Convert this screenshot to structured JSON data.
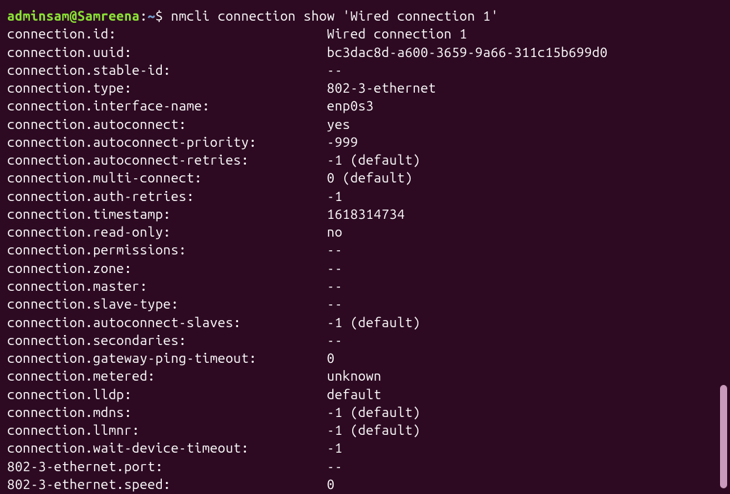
{
  "prompt": {
    "user_host": "adminsam@Samreena",
    "colon": ":",
    "path": "~",
    "dollar": "$ ",
    "command": "nmcli connection show 'Wired connection 1'"
  },
  "properties": [
    {
      "key": "connection.id:",
      "value": "Wired connection 1"
    },
    {
      "key": "connection.uuid:",
      "value": "bc3dac8d-a600-3659-9a66-311c15b699d0"
    },
    {
      "key": "connection.stable-id:",
      "value": "--"
    },
    {
      "key": "connection.type:",
      "value": "802-3-ethernet"
    },
    {
      "key": "connection.interface-name:",
      "value": "enp0s3"
    },
    {
      "key": "connection.autoconnect:",
      "value": "yes"
    },
    {
      "key": "connection.autoconnect-priority:",
      "value": "-999"
    },
    {
      "key": "connection.autoconnect-retries:",
      "value": "-1 (default)"
    },
    {
      "key": "connection.multi-connect:",
      "value": "0 (default)"
    },
    {
      "key": "connection.auth-retries:",
      "value": "-1"
    },
    {
      "key": "connection.timestamp:",
      "value": "1618314734"
    },
    {
      "key": "connection.read-only:",
      "value": "no"
    },
    {
      "key": "connection.permissions:",
      "value": "--"
    },
    {
      "key": "connection.zone:",
      "value": "--"
    },
    {
      "key": "connection.master:",
      "value": "--"
    },
    {
      "key": "connection.slave-type:",
      "value": "--"
    },
    {
      "key": "connection.autoconnect-slaves:",
      "value": "-1 (default)"
    },
    {
      "key": "connection.secondaries:",
      "value": "--"
    },
    {
      "key": "connection.gateway-ping-timeout:",
      "value": "0"
    },
    {
      "key": "connection.metered:",
      "value": "unknown"
    },
    {
      "key": "connection.lldp:",
      "value": "default"
    },
    {
      "key": "connection.mdns:",
      "value": "-1 (default)"
    },
    {
      "key": "connection.llmnr:",
      "value": "-1 (default)"
    },
    {
      "key": "connection.wait-device-timeout:",
      "value": "-1"
    },
    {
      "key": "802-3-ethernet.port:",
      "value": "--"
    },
    {
      "key": "802-3-ethernet.speed:",
      "value": "0"
    }
  ],
  "key_column_width": 41
}
